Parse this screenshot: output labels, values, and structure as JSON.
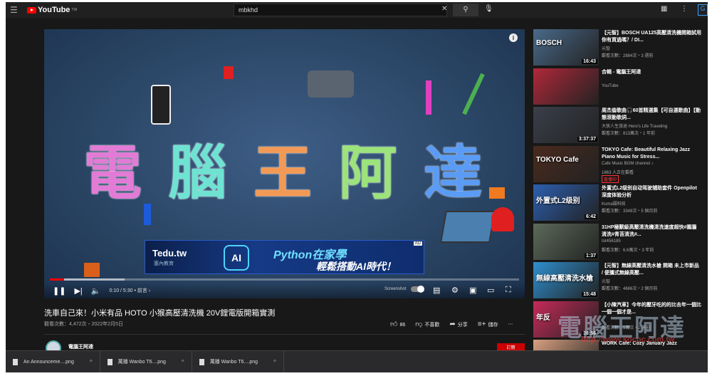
{
  "header": {
    "logo": "YouTube",
    "region": "TW",
    "search_value": "mbkhd",
    "avatar_letter": "G"
  },
  "player": {
    "overlay_title": [
      "電",
      "腦",
      "王",
      "阿",
      "達"
    ],
    "overlay_colors": [
      "#e37ad6",
      "#6fe3d2",
      "#f29a55",
      "#9be37a",
      "#5a9cf5"
    ],
    "ad": {
      "brand": "Tedu.tw",
      "brand_sub": "塞內教育",
      "ai_label": "AI",
      "line1": "Python在家學",
      "line2": "輕鬆搭動AI時代！",
      "ad_badge": "AD"
    },
    "time": "0:10 / 5:30 • 前言 ›",
    "progress_fraction": 0.03,
    "buffered_fraction": 0.16,
    "screenshot_label": "Screenshot"
  },
  "video": {
    "title": "洗車自己來！小米有品 HOTO 小猴高壓清洗機 20V鋰電版開箱實測",
    "views": "觀看次數：4,472次・2022年2月5日",
    "likes": "86",
    "dislike": "不喜歡",
    "share": "分享",
    "save": "儲存",
    "channel": "電腦王阿達",
    "subscribe": "訂閱"
  },
  "recommendations": [
    {
      "title": "【元智】BOSCH UA125高壓清洗機開箱試用 你有買過嗎？/ DI...",
      "channel": "元智",
      "meta": "觀看次數：2884次・3 週前",
      "duration": "16:43",
      "thumb_text": "BOSCH",
      "color": "#4a6a8a"
    },
    {
      "title": "合輯 - 電腦王阿達",
      "channel": "YouTube",
      "meta": "",
      "duration": "",
      "thumb_text": "",
      "color": "#b0283a"
    },
    {
      "title": "周杰倫歌曲🎧60首精選集【可自選歌曲】【動態滾動歌詞...",
      "channel": "大俠人生旅途 Hero's Life Traveling",
      "meta": "觀看次數：813萬次・1 年前",
      "duration": "3:37:37",
      "thumb_text": "",
      "color": "#3a3f4a"
    },
    {
      "title": "TOKYO Cafe: Beautiful Relaxing Jazz Piano Music for Stress...",
      "channel": "Cafe Music BGM channel ♪",
      "meta": "1863 人正在觀看",
      "duration": "",
      "live": "直播中",
      "thumb_text": "TOKYO Cafe",
      "color": "#4a2a1e"
    },
    {
      "title": "外置式L2级别自动驾驶辅助套件 Openpilot深度体验分析",
      "channel": "Kuma摄科技",
      "meta": "觀看次數：3348次・5 個月前",
      "duration": "6:42",
      "thumb_text": "外置式L2级别",
      "color": "#2c5fb0"
    },
    {
      "title": "31HP極獸級高壓清洗機清洗速度超快#圍牆清洗#青苔清洗#...",
      "channel": "tot456185",
      "meta": "觀看次數：6.6萬次・3 年前",
      "duration": "1:37",
      "thumb_text": "",
      "color": "#5c6b5a"
    },
    {
      "title": "【元智】無線高壓清洗水槍 開箱 未上市新品 / 便攜式無線高壓...",
      "channel": "元智",
      "meta": "觀看次數：4686次・2 個月前",
      "duration": "15:48",
      "thumb_text": "無線高壓清洗水槍",
      "color": "#2e8fcf"
    },
    {
      "title": "【小陳汽車】今年的壓牙吃的的比去年一個比一個一個才是...",
      "channel": "",
      "meta": "觀看次數：1萬次・2 天前",
      "duration": "38:56",
      "thumb_text": "年反",
      "color": "#c72a5a"
    },
    {
      "title": "WORK Cafe: Cozy January Jazz",
      "channel": "",
      "meta": "",
      "duration": "",
      "thumb_text": "",
      "color": "#d8a080"
    }
  ],
  "downloads": [
    {
      "name": "An Announceme....png"
    },
    {
      "name": "萬播 Wanbo T6....png"
    },
    {
      "name": "萬播 Wanbo T6....png"
    }
  ],
  "watermark": {
    "text": "電腦王阿達",
    "url": "http://www.kocpc.com.tw"
  }
}
